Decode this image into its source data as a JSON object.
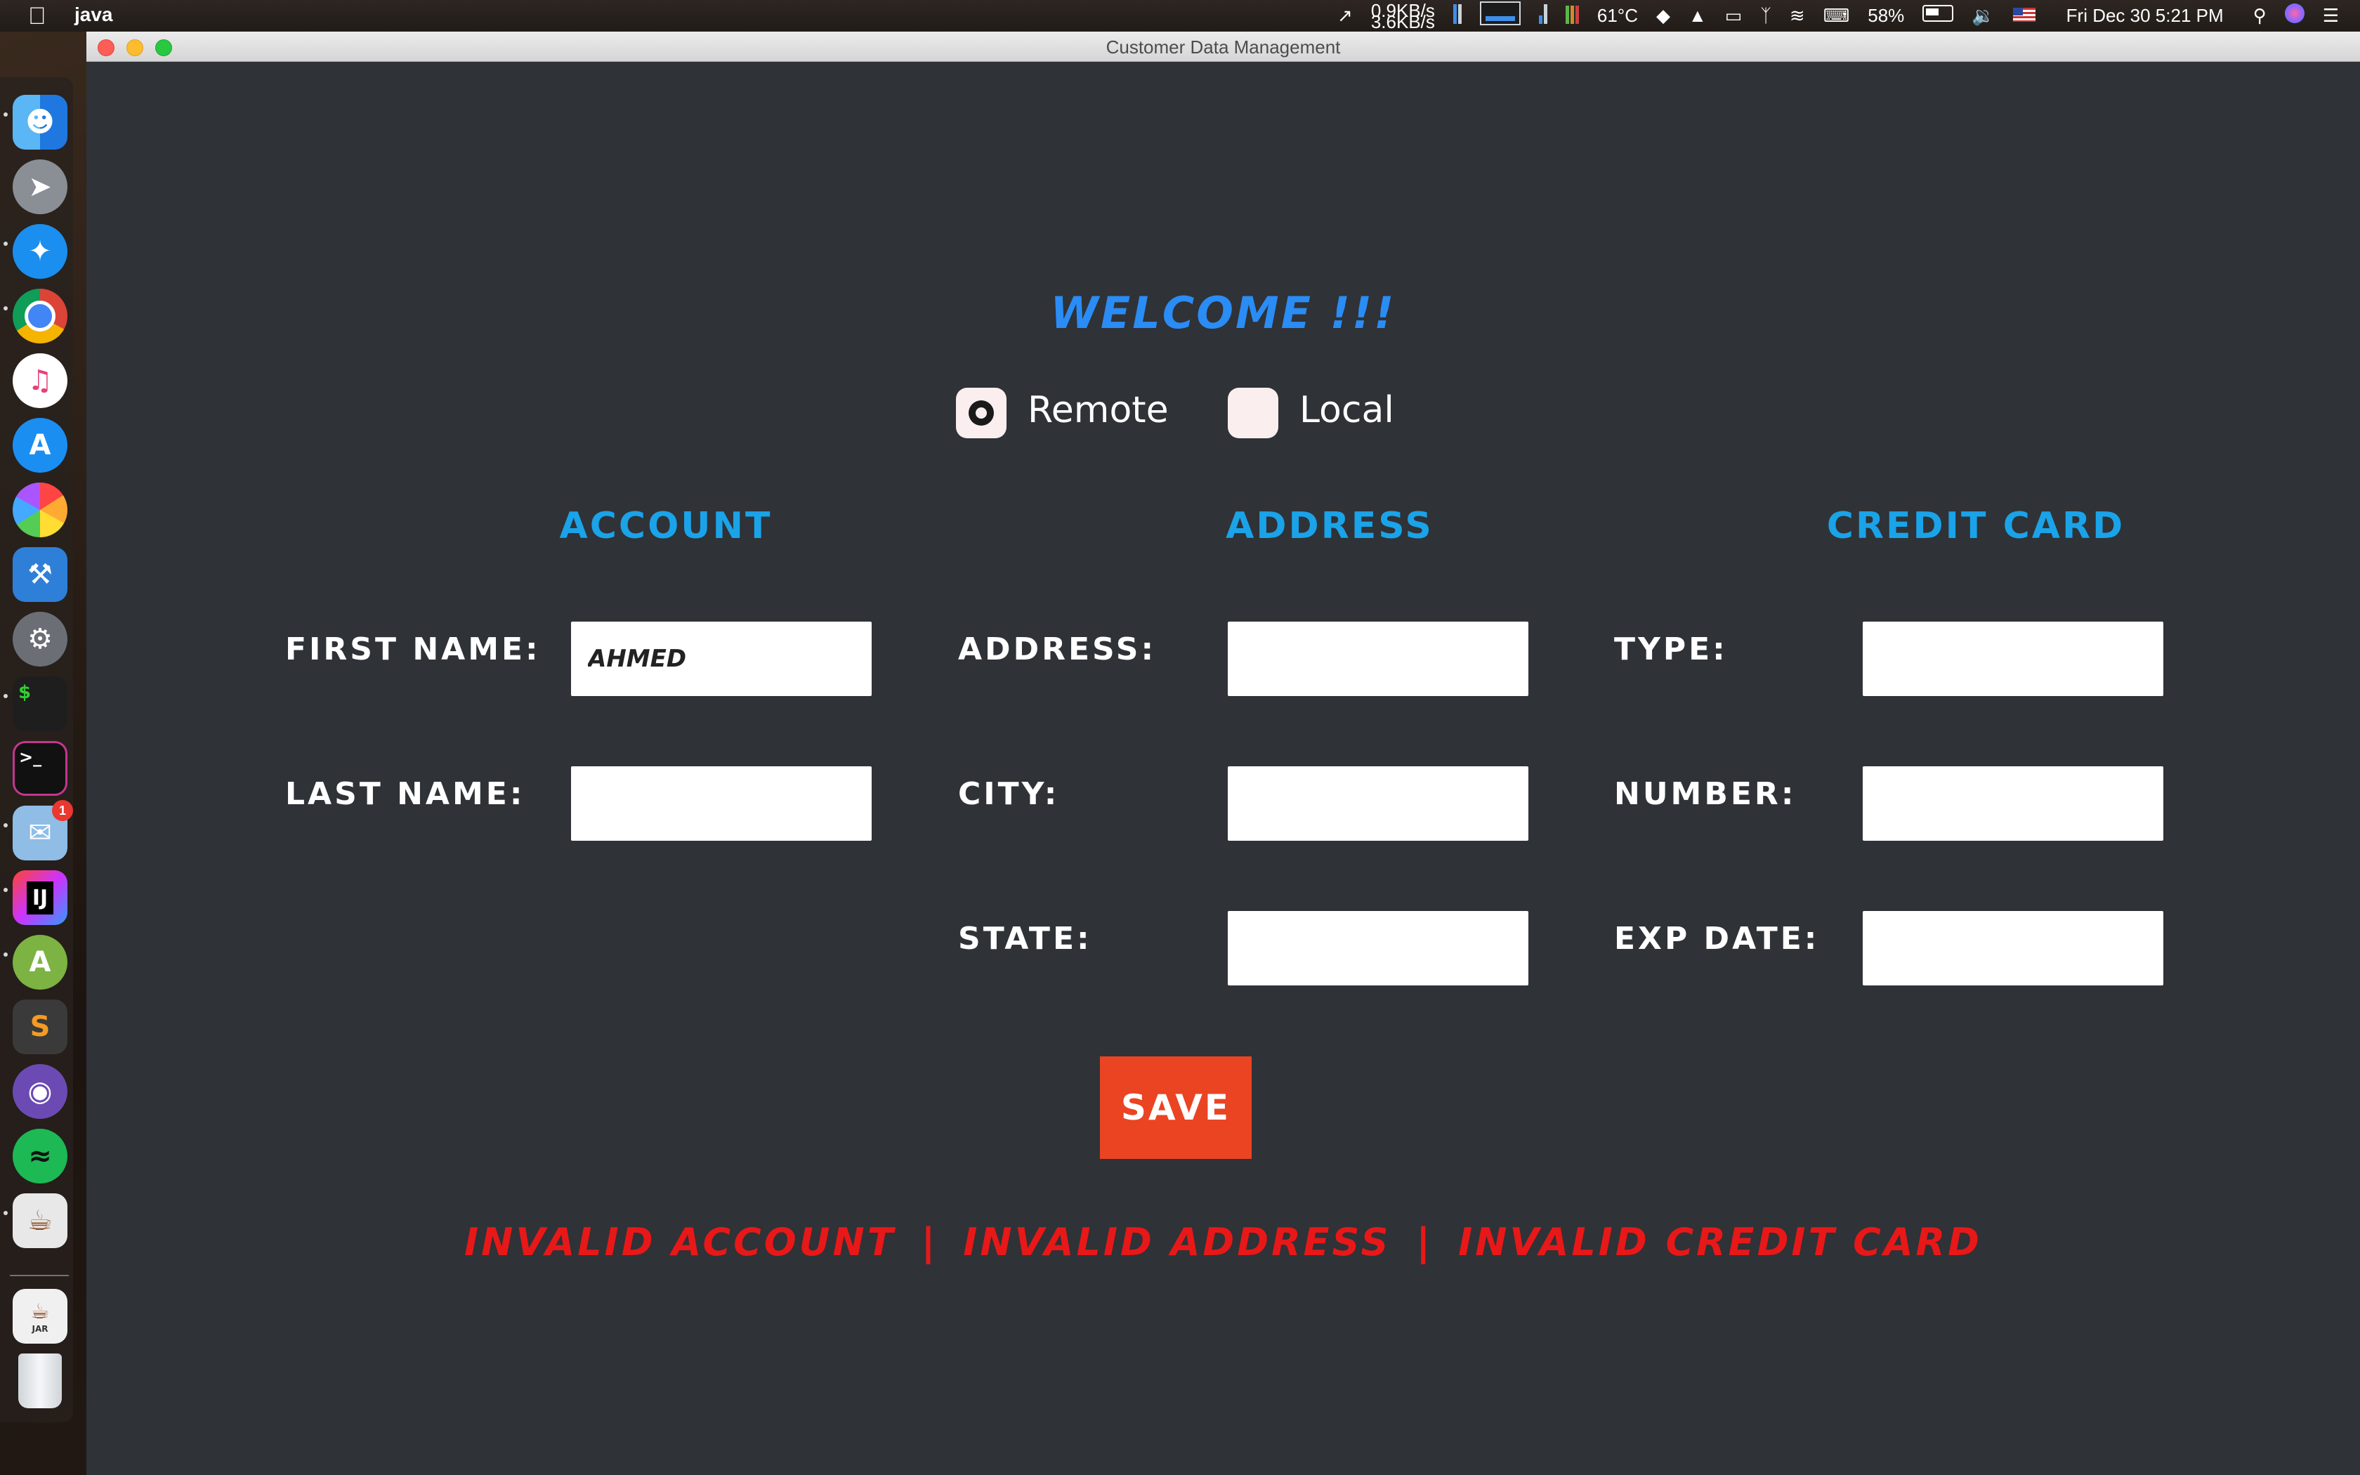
{
  "menubar": {
    "app_name": "java",
    "net_up": "0.9KB/s",
    "net_down": "3.6KB/s",
    "temperature": "61°C",
    "battery": "58%",
    "datetime": "Fri Dec 30  5:21 PM"
  },
  "dock": {
    "apps": [
      "finder-icon",
      "launchpad-icon",
      "safari-icon",
      "chrome-icon",
      "itunes-icon",
      "app-store-icon",
      "photos-icon",
      "xcode-icon",
      "system-preferences-icon",
      "terminal-icon",
      "iterm-icon",
      "mail-icon",
      "intellij-icon",
      "android-studio-icon",
      "sublime-text-icon",
      "github-desktop-icon",
      "spotify-icon",
      "java-icon"
    ],
    "mail_badge": "1",
    "jar_label": "JAR"
  },
  "window": {
    "title": "Customer Data Management"
  },
  "form": {
    "welcome": "WELCOME !!!",
    "radio_remote": "Remote",
    "radio_local": "Local",
    "selected_mode": "Remote",
    "sections": {
      "account": "ACCOUNT",
      "address": "ADDRESS",
      "credit_card": "CREDIT CARD"
    },
    "account": {
      "first_name_label": "FIRST NAME:",
      "first_name_value": "AHMED",
      "last_name_label": "LAST NAME:",
      "last_name_value": ""
    },
    "address": {
      "address_label": "ADDRESS:",
      "address_value": "",
      "city_label": "CITY:",
      "city_value": "",
      "state_label": "STATE:",
      "state_value": ""
    },
    "credit_card": {
      "type_label": "TYPE:",
      "type_value": "",
      "number_label": "NUMBER:",
      "number_value": "",
      "exp_label": "EXP DATE:",
      "exp_value": ""
    },
    "save_label": "SAVE",
    "errors": {
      "account": "INVALID ACCOUNT",
      "address": "INVALID ADDRESS",
      "credit_card": "INVALID CREDIT CARD",
      "separator": "|"
    }
  },
  "colors": {
    "window_bg": "#2f3237",
    "welcome": "#2a8cf5",
    "section_heading": "#1aa3e8",
    "save_button": "#ea4423",
    "error_text": "#e81818"
  }
}
